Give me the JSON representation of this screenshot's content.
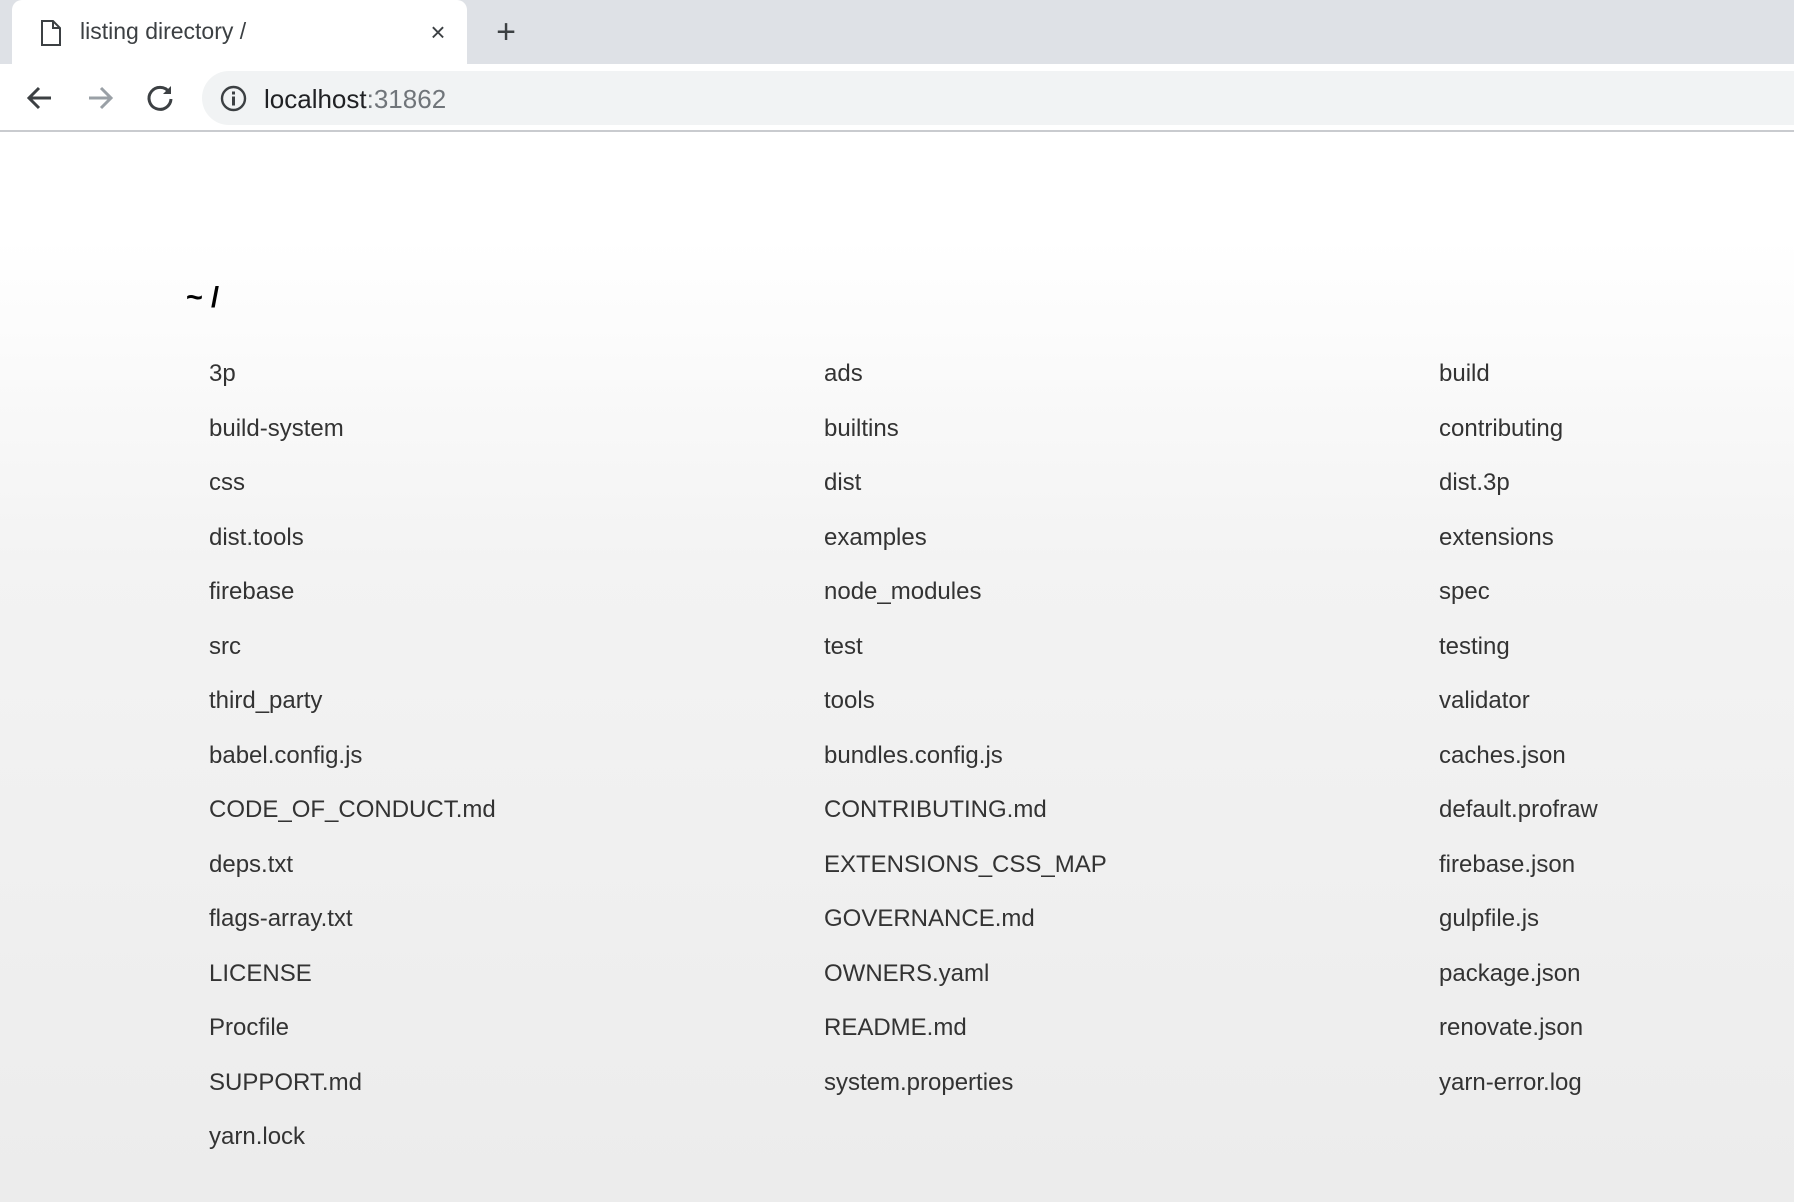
{
  "browser": {
    "tab": {
      "title": "listing directory /",
      "close_symbol": "×",
      "icon": "page-icon"
    },
    "new_tab_symbol": "+",
    "url": {
      "host": "localhost",
      "port": ":31862"
    },
    "icons": {
      "back": "back-arrow-icon",
      "forward": "forward-arrow-icon",
      "reload": "reload-icon",
      "info": "info-icon"
    }
  },
  "page": {
    "heading": "~ /",
    "files": [
      "3p",
      "ads",
      "build",
      "build-system",
      "builtins",
      "contributing",
      "css",
      "dist",
      "dist.3p",
      "dist.tools",
      "examples",
      "extensions",
      "firebase",
      "node_modules",
      "spec",
      "src",
      "test",
      "testing",
      "third_party",
      "tools",
      "validator",
      "babel.config.js",
      "bundles.config.js",
      "caches.json",
      "CODE_OF_CONDUCT.md",
      "CONTRIBUTING.md",
      "default.profraw",
      "deps.txt",
      "EXTENSIONS_CSS_MAP",
      "firebase.json",
      "flags-array.txt",
      "GOVERNANCE.md",
      "gulpfile.js",
      "LICENSE",
      "OWNERS.yaml",
      "package.json",
      "Procfile",
      "README.md",
      "renovate.json",
      "SUPPORT.md",
      "system.properties",
      "yarn-error.log",
      "yarn.lock"
    ]
  },
  "colors": {
    "chrome_bg": "#dee1e6",
    "omnibox_bg": "#f1f3f4",
    "link_text": "#333333"
  }
}
